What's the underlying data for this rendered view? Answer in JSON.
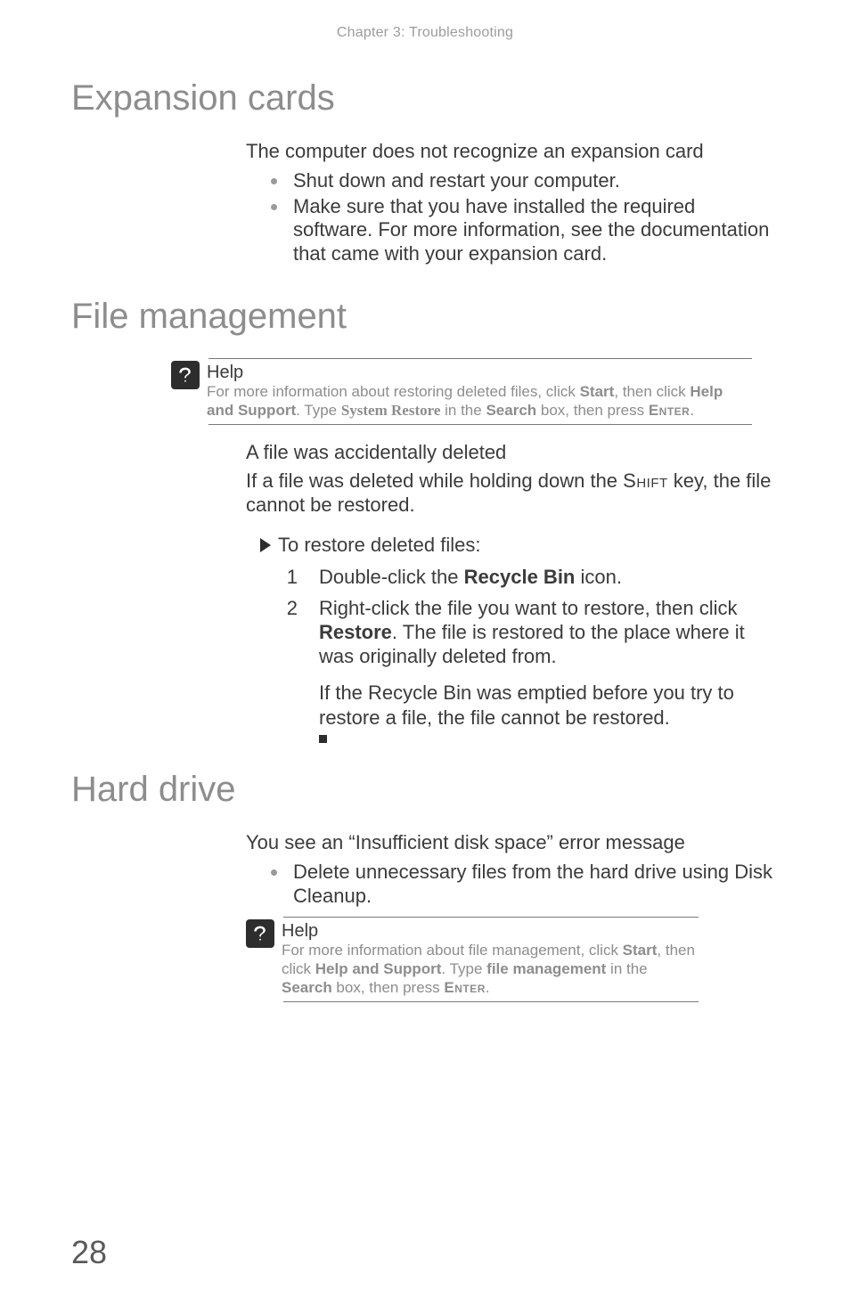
{
  "running_head": "Chapter 3: Troubleshooting",
  "page_number": "28",
  "expansion": {
    "title": "Expansion cards",
    "subhead": "The computer does not recognize an expansion card",
    "bullets": [
      "Shut down and restart your computer.",
      "Make sure that you have installed the required software. For more information, see the documentation that came with your expansion card."
    ]
  },
  "filemgmt": {
    "title": "File management",
    "help": {
      "title": "Help",
      "prefix": "For more information about restoring deleted files, click ",
      "start": "Start",
      "mid1": ", then click ",
      "has": "Help and Support",
      "mid2": ". Type ",
      "search_term": "System Restore",
      "mid3": " in the ",
      "search": "Search",
      "mid4": " box, then press ",
      "enter": "Enter",
      "tail": "."
    },
    "subhead": "A file was accidentally deleted",
    "body_pre": "If a file was deleted while holding down the ",
    "shift_key": "Shift",
    "body_post": " key, the file cannot be restored.",
    "step_head": "To restore deleted files:",
    "steps": {
      "s1_pre": "Double-click the ",
      "s1_bold": "Recycle Bin",
      "s1_post": " icon.",
      "s2_pre": "Right-click the file you want to restore, then click ",
      "s2_bold": "Restore",
      "s2_post": ". The file is restored to the place where it was originally deleted from."
    },
    "tail": "If the Recycle Bin was emptied before you try to restore a file, the file cannot be restored."
  },
  "harddrive": {
    "title": "Hard drive",
    "subhead": "You see an “Insufficient disk space” error message",
    "bullets": [
      "Delete unnecessary files from the hard drive using Disk Cleanup."
    ],
    "help": {
      "title": "Help",
      "prefix": "For more information about file management, click ",
      "start": "Start",
      "mid1": ", then click ",
      "has": "Help and Support",
      "mid2": ". Type ",
      "search_term": "file management",
      "mid3": " in the ",
      "search": "Search",
      "mid4": " box, then press ",
      "enter": "Enter",
      "tail": "."
    }
  }
}
